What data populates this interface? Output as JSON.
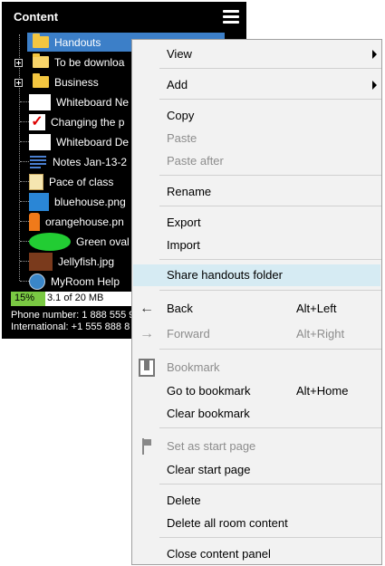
{
  "panel": {
    "title": "Content",
    "tree": [
      {
        "label": "Handouts",
        "icon": "folder-icon"
      },
      {
        "label": "To be downloa",
        "icon": "folder-open-icon"
      },
      {
        "label": "Business",
        "icon": "folder-icon"
      },
      {
        "label": "Whiteboard Ne",
        "icon": "whiteboard-page-icon"
      },
      {
        "label": "Changing the p",
        "icon": "checkmark-icon"
      },
      {
        "label": "Whiteboard De",
        "icon": "whiteboard-page-icon"
      },
      {
        "label": "Notes Jan-13-2",
        "icon": "notes-icon"
      },
      {
        "label": "Pace of class",
        "icon": "document-icon"
      },
      {
        "label": "bluehouse.png",
        "icon": "blue-house-image-icon"
      },
      {
        "label": "orangehouse.pn",
        "icon": "orange-house-image-icon"
      },
      {
        "label": "Green oval",
        "icon": "green-oval-icon"
      },
      {
        "label": "Jellyfish.jpg",
        "icon": "jellyfish-image-icon"
      },
      {
        "label": "MyRoom Help",
        "icon": "globe-icon"
      }
    ],
    "quota": {
      "percent_label": "15%",
      "percent": 15,
      "usage": "3.1 of 20 MB"
    },
    "phone": "Phone number: 1 888 555 9",
    "international": "International:  +1 555 888 8"
  },
  "menu": {
    "view": "View",
    "add": "Add",
    "copy": "Copy",
    "paste": "Paste",
    "paste_after": "Paste after",
    "rename": "Rename",
    "export": "Export",
    "import": "Import",
    "share": "Share handouts folder",
    "back": "Back",
    "back_shortcut": "Alt+Left",
    "forward": "Forward",
    "forward_shortcut": "Alt+Right",
    "bookmark": "Bookmark",
    "go_bookmark": "Go to bookmark",
    "go_bookmark_shortcut": "Alt+Home",
    "clear_bookmark": "Clear bookmark",
    "set_start": "Set as start page",
    "clear_start": "Clear start page",
    "delete": "Delete",
    "delete_all": "Delete all room content",
    "close_panel": "Close content panel"
  },
  "colors": {
    "selected": "#3c7fc8",
    "hover": "#d6ebf3",
    "quota_fill": "#7ac943"
  }
}
